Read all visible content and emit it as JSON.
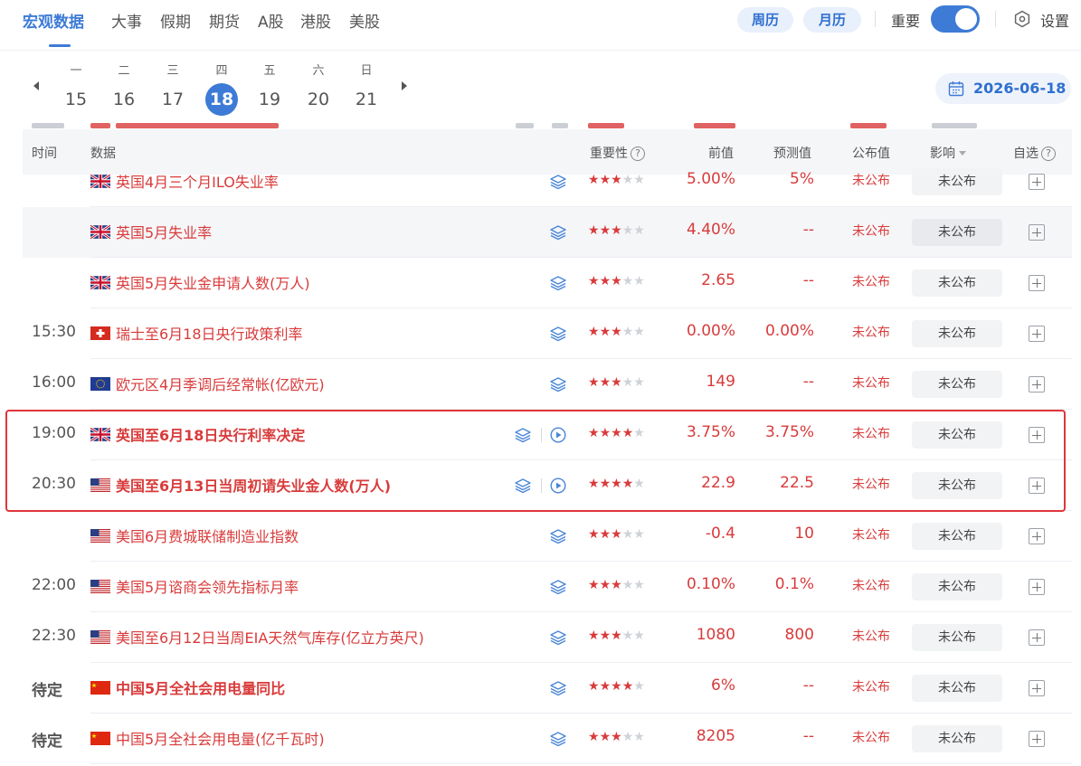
{
  "nav": {
    "tabs": [
      "宏观数据",
      "大事",
      "假期",
      "期货",
      "A股",
      "港股",
      "美股"
    ],
    "active_tab": "宏观数据",
    "view_week": "周历",
    "view_month": "月历",
    "important_label": "重要",
    "important_on": true,
    "settings_label": "设置"
  },
  "days": [
    {
      "weekday": "一",
      "day": "15"
    },
    {
      "weekday": "二",
      "day": "16"
    },
    {
      "weekday": "三",
      "day": "17"
    },
    {
      "weekday": "四",
      "day": "18",
      "active": true
    },
    {
      "weekday": "五",
      "day": "19"
    },
    {
      "weekday": "六",
      "day": "20"
    },
    {
      "weekday": "日",
      "day": "21"
    }
  ],
  "current_date": "2026-06-18",
  "table": {
    "headers": {
      "time": "时间",
      "data": "数据",
      "importance": "重要性",
      "prev": "前值",
      "forecast": "预测值",
      "published": "公布值",
      "impact": "影响",
      "watch": "自选"
    },
    "rows": [
      {
        "time": "",
        "flag": "uk",
        "name": "英国4月三个月ILO失业率",
        "stars": 3,
        "prev": "5.00%",
        "forecast": "5%",
        "published": "未公布",
        "impact": "未公布"
      },
      {
        "time": "",
        "flag": "uk",
        "name": "英国5月失业率",
        "stars": 3,
        "prev": "4.40%",
        "forecast": "--",
        "published": "未公布",
        "impact": "未公布",
        "highlight": true
      },
      {
        "time": "",
        "flag": "uk",
        "name": "英国5月失业金申请人数(万人)",
        "stars": 3,
        "prev": "2.65",
        "forecast": "--",
        "published": "未公布",
        "impact": "未公布"
      },
      {
        "time": "15:30",
        "flag": "ch",
        "name": "瑞士至6月18日央行政策利率",
        "stars": 3,
        "prev": "0.00%",
        "forecast": "0.00%",
        "published": "未公布",
        "impact": "未公布"
      },
      {
        "time": "16:00",
        "flag": "eu",
        "name": "欧元区4月季调后经常帐(亿欧元)",
        "stars": 3,
        "prev": "149",
        "forecast": "--",
        "published": "未公布",
        "impact": "未公布"
      },
      {
        "time": "19:00",
        "flag": "uk",
        "name": "英国至6月18日央行利率决定",
        "stars": 4,
        "prev": "3.75%",
        "forecast": "3.75%",
        "published": "未公布",
        "impact": "未公布",
        "bold": true,
        "video": true
      },
      {
        "time": "20:30",
        "flag": "us",
        "name": "美国至6月13日当周初请失业金人数(万人)",
        "stars": 4,
        "prev": "22.9",
        "forecast": "22.5",
        "published": "未公布",
        "impact": "未公布",
        "bold": true,
        "video": true
      },
      {
        "time": "",
        "flag": "us",
        "name": "美国6月费城联储制造业指数",
        "stars": 3,
        "prev": "-0.4",
        "forecast": "10",
        "published": "未公布",
        "impact": "未公布"
      },
      {
        "time": "22:00",
        "flag": "us",
        "name": "美国5月谘商会领先指标月率",
        "stars": 3,
        "prev": "0.10%",
        "forecast": "0.1%",
        "published": "未公布",
        "impact": "未公布"
      },
      {
        "time": "22:30",
        "flag": "us",
        "name": "美国至6月12日当周EIA天然气库存(亿立方英尺)",
        "stars": 3,
        "prev": "1080",
        "forecast": "800",
        "published": "未公布",
        "impact": "未公布"
      },
      {
        "time": "待定",
        "flag": "cn",
        "name": "中国5月全社会用电量同比",
        "stars": 4,
        "prev": "6%",
        "forecast": "--",
        "published": "未公布",
        "impact": "未公布",
        "bold": true,
        "time_bold": true
      },
      {
        "time": "待定",
        "flag": "cn",
        "name": "中国5月全社会用电量(亿千瓦时)",
        "stars": 3,
        "prev": "8205",
        "forecast": "--",
        "published": "未公布",
        "impact": "未公布",
        "time_bold": true
      }
    ]
  },
  "colors": {
    "accent": "#3d7bd6",
    "value_red": "#d93b3b",
    "highlight_border": "#e0363a"
  },
  "icons": {
    "layers": "layers-icon",
    "video": "play-circle-icon",
    "add": "add-watch-icon",
    "settings": "settings-icon",
    "calendar": "calendar-icon"
  }
}
